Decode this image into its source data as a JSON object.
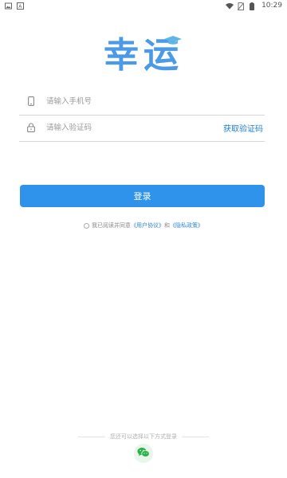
{
  "status_bar": {
    "time": "10:29"
  },
  "logo": {
    "text": "幸运"
  },
  "phone": {
    "placeholder": "请输入手机号",
    "icon": "phone-icon"
  },
  "code": {
    "placeholder": "请输入验证码",
    "icon": "lock-icon",
    "get_code_label": "获取验证码"
  },
  "login": {
    "label": "登录"
  },
  "agreement": {
    "prefix": "我已阅读并同意",
    "user_agreement": "《用户协议》",
    "and": "和",
    "privacy_policy": "《隐私政策》"
  },
  "other_login": {
    "label": "您还可以选择以下方式登录",
    "wechat_icon": "wechat-icon"
  },
  "colors": {
    "accent": "#2f93ec",
    "link": "#2f86d6",
    "wechat": "#2bb24c"
  }
}
